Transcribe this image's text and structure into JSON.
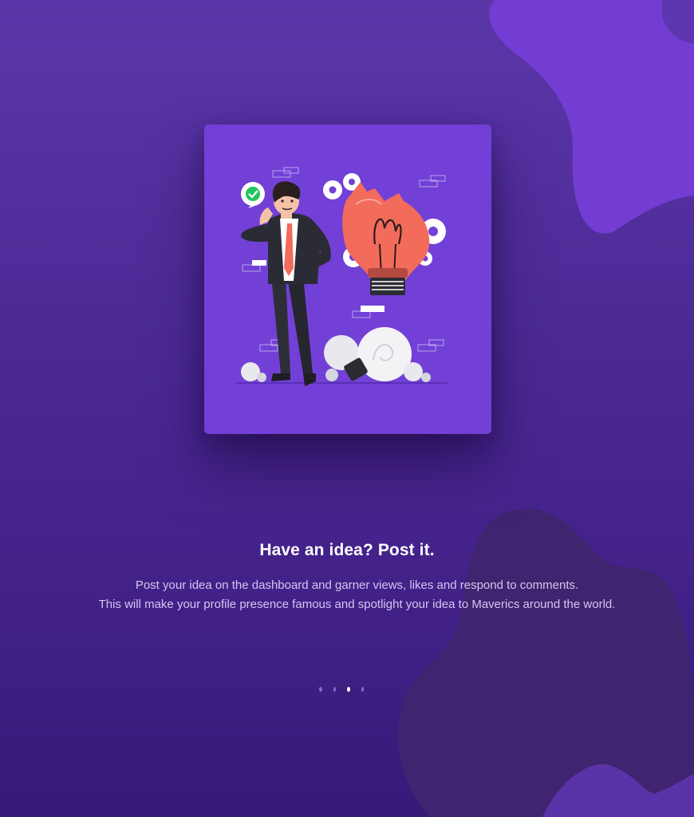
{
  "onboarding": {
    "title": "Have an idea? Post it.",
    "description_lines": [
      "Post your idea on the dashboard and garner views, likes and respond to comments.",
      "This will make your profile presence famous and spotlight your idea to Maverics around the world."
    ],
    "illustration": "businessman-with-broken-lightbulb-illustration",
    "pagination": {
      "total": 4,
      "active_index": 2
    }
  },
  "colors": {
    "background": "#4e2c98",
    "card": "#7240d6",
    "accent_bulb": "#f26b5b",
    "dot_inactive": "#8b65d6",
    "dot_active": "#ffffff"
  }
}
